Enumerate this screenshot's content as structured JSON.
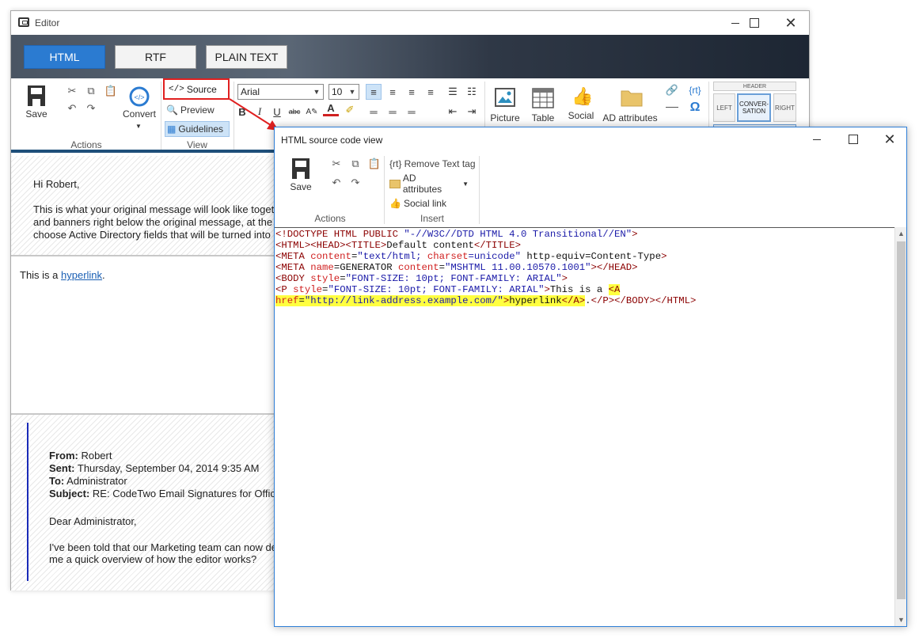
{
  "editor": {
    "title": "Editor",
    "modes": [
      "HTML",
      "RTF",
      "PLAIN TEXT"
    ],
    "ribbon": {
      "actions": {
        "save_label": "Save",
        "convert_label": "Convert",
        "group_label": "Actions"
      },
      "view": {
        "source_label": "Source",
        "preview_label": "Preview",
        "guidelines_label": "Guidelines",
        "group_label": "View"
      },
      "format": {
        "font": "Arial",
        "size": "10"
      },
      "insert": {
        "picture_label": "Picture",
        "table_label": "Table",
        "social_label": "Social link",
        "ad_label": "AD attributes",
        "rt_label": "{rt}",
        "omega": "Ω"
      },
      "layout": {
        "header_label": "HEADER",
        "left_label": "LEFT",
        "conversation_label": "CONVER-SATION",
        "right_label": "RIGHT"
      }
    },
    "body": {
      "greeting": "Hi Robert,",
      "para_lines": [
        "This is what your original message will look like toget",
        "and banners right below the original message, at the",
        "choose Active Directory fields that will be turned into"
      ],
      "signature_prefix": "This is a ",
      "hyperlink": "hyperlink",
      "signature_suffix": ".",
      "quote": {
        "from_label": "From:",
        "from_value": " Robert",
        "sent_label": "Sent:",
        "sent_value": " Thursday, September 04, 2014 9:35 AM",
        "to_label": "To:",
        "to_value": " Administrator",
        "subject_label": "Subject:",
        "subject_value": " RE: CodeTwo Email Signatures for Offic",
        "salutation": "Dear Administrator,",
        "lines": [
          "I've been told that our Marketing team can now de",
          "me a quick overview of how the editor works?"
        ]
      }
    }
  },
  "dialog": {
    "title": "HTML source code view",
    "actions": {
      "save_label": "Save",
      "group_label": "Actions"
    },
    "insert": {
      "remove_label": "{rt} Remove Text tag",
      "ad_label": "AD attributes",
      "social_label": "Social link",
      "group_label": "Insert"
    },
    "code": {
      "l1_open": "<!DOCTYPE HTML PUBLIC ",
      "l1_val": "\"-//W3C//DTD HTML 4.0 Transitional//EN\"",
      "l1_close": ">",
      "l2_a": "<HTML><HEAD><TITLE>",
      "l2_b": "Default content",
      "l2_c": "</TITLE>",
      "l3_a": "<META ",
      "l3_b": "content",
      "l3_c": "=",
      "l3_d": "\"text/html; ",
      "l3_e": "charset",
      "l3_f": "=unicode\" ",
      "l3_g": "http-equiv=Content-Type",
      "l3_h": ">",
      "l4_a": "<META ",
      "l4_b": "name",
      "l4_c": "=GENERATOR ",
      "l4_d": "content",
      "l4_e": "=",
      "l4_f": "\"MSHTML 11.00.10570.1001\"",
      "l4_g": "></HEAD>",
      "l5_a": "<BODY ",
      "l5_b": "style",
      "l5_c": "=",
      "l5_d": "\"FONT-SIZE: 10pt; FONT-FAMILY: ARIAL\"",
      "l5_e": ">",
      "l6_a": "<P ",
      "l6_b": "style",
      "l6_c": "=",
      "l6_d": "\"FONT-SIZE: 10pt; FONT-FAMILY: ARIAL\"",
      "l6_e": ">",
      "l6_f": "This is a ",
      "l6_g": "<A",
      "l7_a": "href",
      "l7_b": "=",
      "l7_c": "\"http://link-address.example.com/\"",
      "l7_d": ">",
      "l7_e": "hyperlink",
      "l7_f": "</A>",
      "l7_g": ".",
      "l7_h": "</P></BODY></HTML>"
    }
  }
}
